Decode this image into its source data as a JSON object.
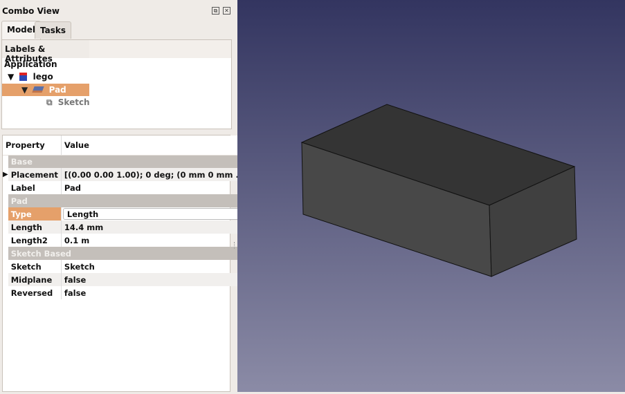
{
  "panel": {
    "title": "Combo View",
    "tabs": [
      {
        "label": "Model"
      },
      {
        "label": "Tasks"
      }
    ]
  },
  "tree": {
    "header": "Labels & Attributes",
    "root": "Application",
    "items": [
      {
        "label": "lego",
        "icon": "document-icon"
      },
      {
        "label": "Pad",
        "icon": "pad-icon",
        "selected": true
      },
      {
        "label": "Sketch",
        "icon": "sketch-icon"
      }
    ]
  },
  "properties": {
    "headers": [
      "Property",
      "Value"
    ],
    "groups": [
      {
        "name": "Base",
        "rows": [
          {
            "key": "Placement",
            "value": "[(0.00 0.00 1.00); 0 deg; (0 mm  0 mm  ..."
          },
          {
            "key": "Label",
            "value": "Pad"
          }
        ]
      },
      {
        "name": "Pad",
        "rows": [
          {
            "key": "Type",
            "value": "Length"
          },
          {
            "key": "Length",
            "value": "14.4 mm"
          },
          {
            "key": "Length2",
            "value": "0.1 m"
          }
        ]
      },
      {
        "name": "Sketch Based",
        "rows": [
          {
            "key": "Sketch",
            "value": "Sketch"
          },
          {
            "key": "Midplane",
            "value": "false"
          },
          {
            "key": "Reversed",
            "value": "false"
          }
        ]
      }
    ]
  },
  "colors": {
    "selection": "#e5a06a",
    "viewport_top": "#333560",
    "viewport_bottom": "#8b8ba6"
  }
}
